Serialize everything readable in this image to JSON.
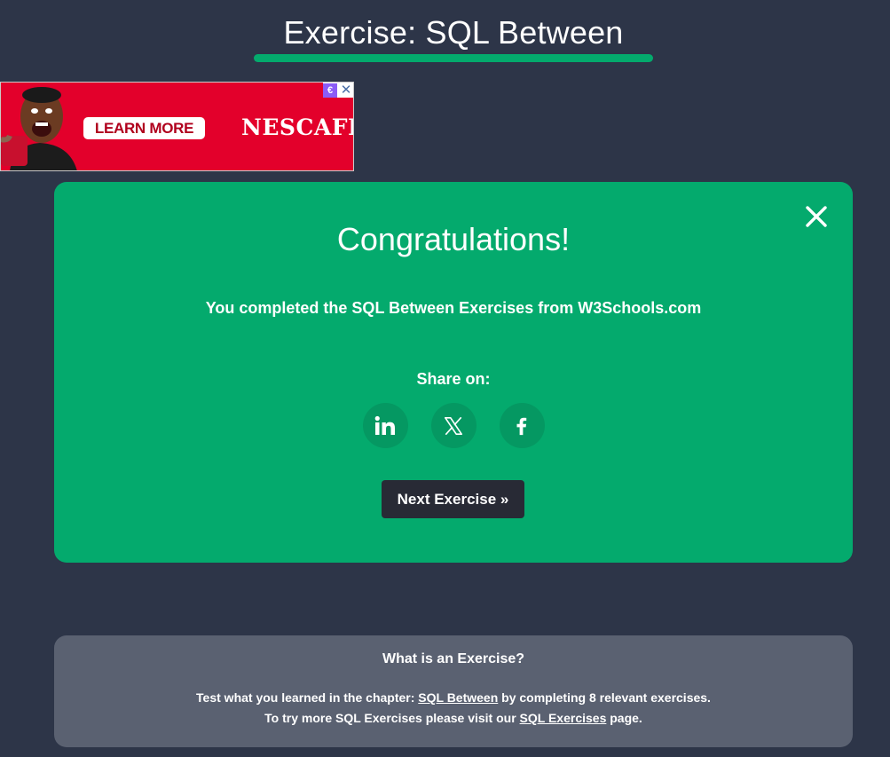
{
  "header": {
    "title": "Exercise: SQL Between"
  },
  "ad": {
    "button_label": "LEARN MORE",
    "brand": "NESCAFÉ",
    "choices_icon": "adchoices-icon",
    "close_icon": "close-icon"
  },
  "congrats": {
    "heading": "Congratulations!",
    "message": "You completed the SQL Between Exercises from W3Schools.com",
    "share_label": "Share on:",
    "share_networks": [
      "linkedin",
      "x",
      "facebook"
    ],
    "next_button_label": "Next Exercise »"
  },
  "info": {
    "heading": "What is an Exercise?",
    "line1_prefix": "Test what you learned in the chapter: ",
    "line1_link": "SQL Between",
    "line1_suffix": " by completing 8 relevant exercises.",
    "line2_prefix": "To try more SQL Exercises please visit our ",
    "line2_link": "SQL Exercises",
    "line2_suffix": " page."
  },
  "colors": {
    "background": "#2d3548",
    "accent": "#04aa6d",
    "button_dark": "#282a35",
    "info_panel": "#5a6171"
  }
}
